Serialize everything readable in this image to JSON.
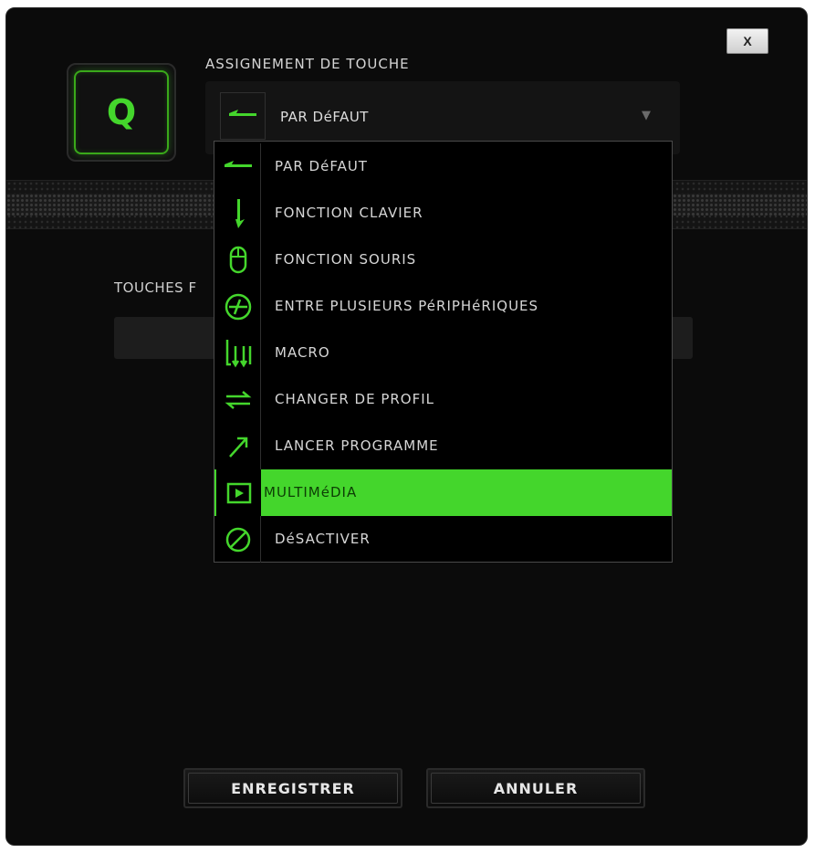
{
  "dialog": {
    "close_label": "X",
    "key_label": "Q",
    "section_title": "ASSIGNEMENT DE TOUCHE",
    "selected_value": "PAR DéFAUT",
    "caret": "▼",
    "touches_label": "TOUCHES F"
  },
  "dropdown": {
    "items": [
      {
        "label": "PAR DéFAUT",
        "icon": "default-arrow-icon"
      },
      {
        "label": "FONCTION CLAVIER",
        "icon": "keyboard-function-icon"
      },
      {
        "label": "FONCTION SOURIS",
        "icon": "mouse-icon"
      },
      {
        "label": "ENTRE PLUSIEURS PéRIPHéRIQUES",
        "icon": "inter-device-icon"
      },
      {
        "label": "MACRO",
        "icon": "macro-icon"
      },
      {
        "label": "CHANGER DE PROFIL",
        "icon": "switch-profile-icon"
      },
      {
        "label": "LANCER PROGRAMME",
        "icon": "launch-program-icon"
      },
      {
        "label": "MULTIMéDIA",
        "icon": "multimedia-icon",
        "active": true
      },
      {
        "label": "DéSACTIVER",
        "icon": "disable-icon"
      }
    ]
  },
  "buttons": {
    "save_label": "ENREGISTRER",
    "cancel_label": "ANNULER"
  },
  "colors": {
    "accent": "#44d62c",
    "background": "#0b0b0b"
  }
}
